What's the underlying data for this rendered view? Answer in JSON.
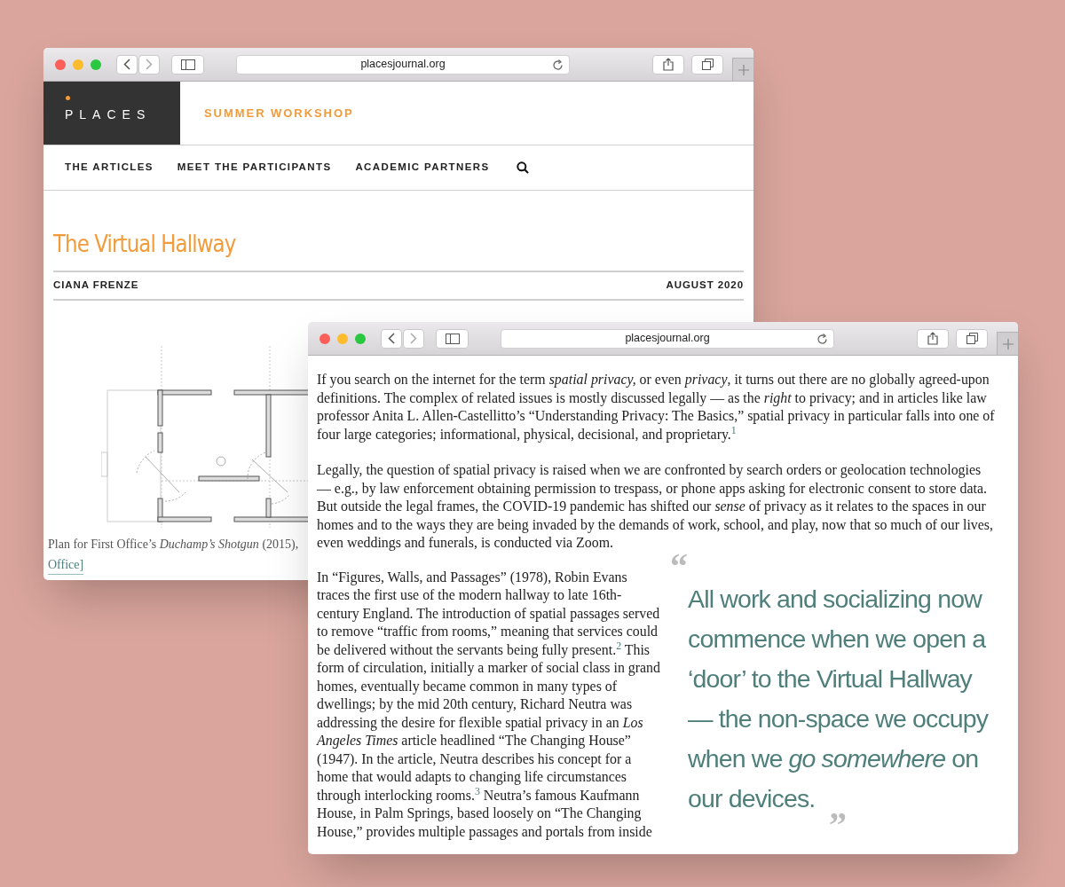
{
  "back_window": {
    "address_bar": {
      "url": "placesjournal.org"
    },
    "site_header": {
      "logo": "PLACES",
      "section_title": "SUMMER WORKSHOP"
    },
    "nav": {
      "items": [
        "THE ARTICLES",
        "MEET THE PARTICIPANTS",
        "ACADEMIC PARTNERS"
      ]
    },
    "article": {
      "title": "The Virtual Hallway",
      "author": "CIANA FRENZE",
      "date": "AUGUST 2020"
    },
    "figure": {
      "caption": "Plan for First Office’s *Duchamp’s Shotgun* (2015),",
      "credit": "Office]"
    }
  },
  "front_window": {
    "address_bar": {
      "url": "placesjournal.org"
    },
    "paragraphs": [
      "If you search on the internet for the term *spatial privacy,* or even *privacy*, it turns out there are no globally agreed-upon definitions. The complex of related issues is mostly discussed legally — as the *right* to privacy; and in articles like law professor Anita L. Allen-Castellitto’s “Understanding Privacy: The Basics,” spatial privacy in particular falls into one of four large categories; informational, physical, decisional, and proprietary.$^{1}$",
      "Legally, the question of spatial privacy is raised when we are confronted by search orders or geolocation technologies — e.g., by law enforcement obtaining permission to trespass, or phone apps asking for electronic consent to store data. But outside the legal frames, the COVID-19 pandemic has shifted our *sense* of privacy as it relates to the spaces in our homes and to the ways they are being invaded by the demands of work, school, and play, now that so much of our lives, even weddings and funerals, is conducted via Zoom."
    ],
    "column_paragraph": "In “Figures, Walls, and Passages” (1978), Robin Evans traces the first use of the modern hallway to late 16th-century England. The introduction of spatial passages served to remove “traffic from rooms,” meaning that services could be delivered without the servants being fully present.$^{2}$ This form of circulation, initially a marker of social class in grand homes, eventually became common in many types of dwellings; by the mid 20th century, Richard Neutra was addressing the desire for flexible spatial privacy in an *Los Angeles Times* article headlined “The Changing House” (1947). In the article, Neutra describes his concept for a home that would adapts to changing life circumstances through interlocking rooms.$^{3}$ Neutra’s famous Kaufmann House, in Palm Springs, based loosely on “The Changing House,” provides multiple passages and portals from inside",
    "pull_quote": {
      "open_mark": "“",
      "text": "All work and socializing now commence when we open a ‘door’ to the Virtual Hallway — the non-space we occupy when we *go somewhere* on our devices.",
      "close_mark": "”"
    }
  }
}
